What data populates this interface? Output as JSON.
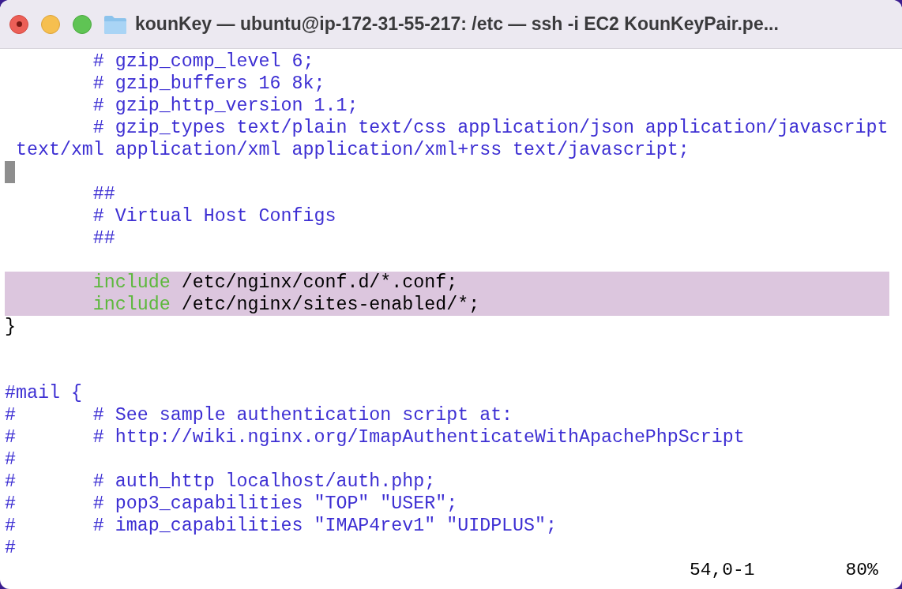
{
  "window": {
    "title": "kounKey — ubuntu@ip-172-31-55-217: /etc — ssh -i EC2 KounKeyPair.pe..."
  },
  "editor": {
    "lines": [
      {
        "kind": "code",
        "segments": [
          {
            "kind": "comment",
            "text": "        # gzip_comp_level 6;"
          }
        ]
      },
      {
        "kind": "code",
        "segments": [
          {
            "kind": "comment",
            "text": "        # gzip_buffers 16 8k;"
          }
        ]
      },
      {
        "kind": "code",
        "segments": [
          {
            "kind": "comment",
            "text": "        # gzip_http_version 1.1;"
          }
        ]
      },
      {
        "kind": "code",
        "segments": [
          {
            "kind": "comment",
            "text": "        # gzip_types text/plain text/css application/json application/javascript"
          }
        ]
      },
      {
        "kind": "code",
        "segments": [
          {
            "kind": "comment",
            "text": " text/xml application/xml application/xml+rss text/javascript;"
          }
        ]
      },
      {
        "kind": "blank",
        "cursor": true
      },
      {
        "kind": "code",
        "segments": [
          {
            "kind": "comment",
            "text": "        ##"
          }
        ]
      },
      {
        "kind": "code",
        "segments": [
          {
            "kind": "comment",
            "text": "        # Virtual Host Configs"
          }
        ]
      },
      {
        "kind": "code",
        "segments": [
          {
            "kind": "comment",
            "text": "        ##"
          }
        ]
      },
      {
        "kind": "blank"
      },
      {
        "kind": "code",
        "highlighted": true,
        "segments": [
          {
            "kind": "keyword",
            "text": "        include"
          },
          {
            "kind": "plain",
            "text": " /etc/nginx/conf.d/*.conf;"
          }
        ]
      },
      {
        "kind": "code",
        "highlighted": true,
        "segments": [
          {
            "kind": "keyword",
            "text": "        include"
          },
          {
            "kind": "plain",
            "text": " /etc/nginx/sites-enabled/*;"
          }
        ]
      },
      {
        "kind": "code",
        "segments": [
          {
            "kind": "plain",
            "text": "}"
          }
        ]
      },
      {
        "kind": "blank"
      },
      {
        "kind": "blank"
      },
      {
        "kind": "code",
        "segments": [
          {
            "kind": "comment",
            "text": "#mail {"
          }
        ]
      },
      {
        "kind": "code",
        "segments": [
          {
            "kind": "comment",
            "text": "#       # See sample authentication script at:"
          }
        ]
      },
      {
        "kind": "code",
        "segments": [
          {
            "kind": "comment",
            "text": "#       # http://wiki.nginx.org/ImapAuthenticateWithApachePhpScript"
          }
        ]
      },
      {
        "kind": "code",
        "segments": [
          {
            "kind": "comment",
            "text": "#"
          }
        ]
      },
      {
        "kind": "code",
        "segments": [
          {
            "kind": "comment",
            "text": "#       # auth_http localhost/auth.php;"
          }
        ]
      },
      {
        "kind": "code",
        "segments": [
          {
            "kind": "comment",
            "text": "#       # pop3_capabilities \"TOP\" \"USER\";"
          }
        ]
      },
      {
        "kind": "code",
        "segments": [
          {
            "kind": "comment",
            "text": "#       # imap_capabilities \"IMAP4rev1\" \"UIDPLUS\";"
          }
        ]
      },
      {
        "kind": "code",
        "segments": [
          {
            "kind": "comment",
            "text": "#"
          }
        ]
      }
    ]
  },
  "status_bar": {
    "position": "54,0-1",
    "scroll": "80%"
  }
}
